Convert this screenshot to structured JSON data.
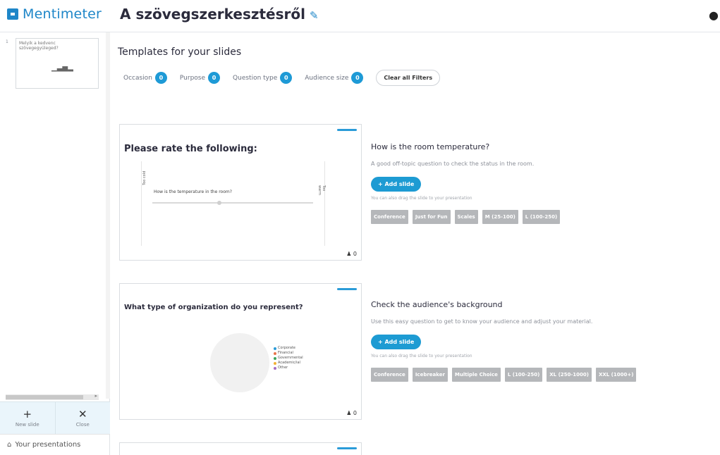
{
  "header": {
    "logo_text": "Mentimeter",
    "title": "A szövegszerkesztésről",
    "edit_icon": "pencil-icon",
    "right_icon": "drop-icon"
  },
  "sidebar": {
    "slides": [
      {
        "number": "1",
        "text": "Melyik a kedvenc szövegegyüleged?",
        "icon": "bar-chart-icon"
      }
    ],
    "new_slide": "New slide",
    "close": "Close",
    "your_presentations": "Your presentations"
  },
  "main": {
    "heading": "Templates for your slides",
    "filters": [
      {
        "label": "Occasion",
        "count": "0"
      },
      {
        "label": "Purpose",
        "count": "0"
      },
      {
        "label": "Question type",
        "count": "0"
      },
      {
        "label": "Audience size",
        "count": "0"
      }
    ],
    "clear_filters": "Clear all Filters",
    "templates": [
      {
        "slide_title": "Please rate the following:",
        "question": "How is the temperature in the room?",
        "scale_left": "Too cold",
        "scale_right": "Too warm",
        "participants": "0",
        "title": "How is the room temperature?",
        "description": "A good off-topic question to check the status in the room.",
        "add_label": "+ Add slide",
        "drag_note": "You can also drag the slide to your presentation",
        "tags": [
          "Conference",
          "Just for Fun",
          "Scales",
          "M (25-100)",
          "L (100-250)"
        ]
      },
      {
        "slide_title": "What type of organization do you represent?",
        "legend": [
          "Corporate",
          "Financial",
          "Governmental",
          "Academic/ial",
          "Other"
        ],
        "participants": "0",
        "title": "Check the audience's background",
        "description": "Use this easy question to get to know your audience and adjust your material.",
        "add_label": "+ Add slide",
        "drag_note": "You can also drag the slide to your presentation",
        "tags": [
          "Conference",
          "Icebreaker",
          "Multiple Choice",
          "L (100-250)",
          "XL (250-1000)",
          "XXL (1000+)"
        ]
      }
    ]
  },
  "colors": {
    "accent": "#1e9ad6",
    "tag_bg": "#b5b7ba",
    "legend_colors": [
      "#2a9bd8",
      "#e8734a",
      "#3ba55c",
      "#f2b233",
      "#a66cc1"
    ]
  }
}
